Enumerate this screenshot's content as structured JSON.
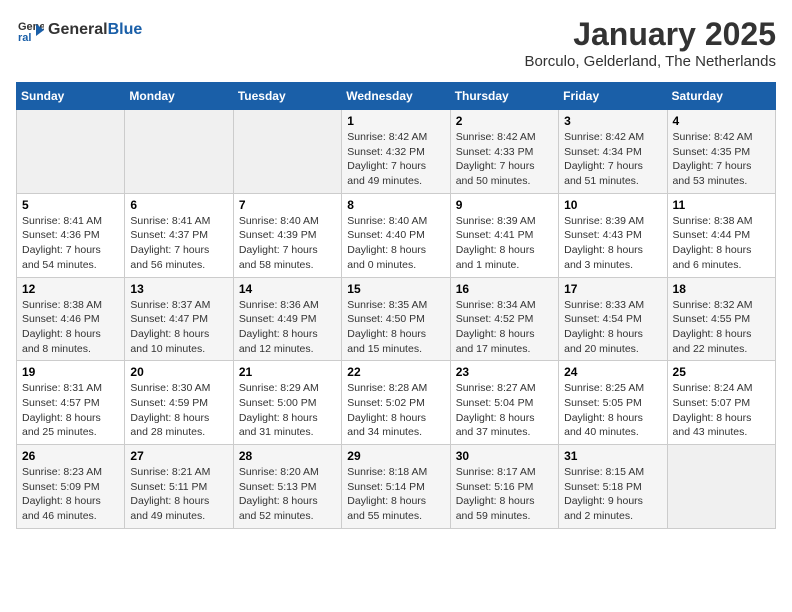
{
  "header": {
    "logo_general": "General",
    "logo_blue": "Blue",
    "title": "January 2025",
    "subtitle": "Borculo, Gelderland, The Netherlands"
  },
  "days_of_week": [
    "Sunday",
    "Monday",
    "Tuesday",
    "Wednesday",
    "Thursday",
    "Friday",
    "Saturday"
  ],
  "weeks": [
    [
      {
        "day": "",
        "info": ""
      },
      {
        "day": "",
        "info": ""
      },
      {
        "day": "",
        "info": ""
      },
      {
        "day": "1",
        "info": "Sunrise: 8:42 AM\nSunset: 4:32 PM\nDaylight: 7 hours and 49 minutes."
      },
      {
        "day": "2",
        "info": "Sunrise: 8:42 AM\nSunset: 4:33 PM\nDaylight: 7 hours and 50 minutes."
      },
      {
        "day": "3",
        "info": "Sunrise: 8:42 AM\nSunset: 4:34 PM\nDaylight: 7 hours and 51 minutes."
      },
      {
        "day": "4",
        "info": "Sunrise: 8:42 AM\nSunset: 4:35 PM\nDaylight: 7 hours and 53 minutes."
      }
    ],
    [
      {
        "day": "5",
        "info": "Sunrise: 8:41 AM\nSunset: 4:36 PM\nDaylight: 7 hours and 54 minutes."
      },
      {
        "day": "6",
        "info": "Sunrise: 8:41 AM\nSunset: 4:37 PM\nDaylight: 7 hours and 56 minutes."
      },
      {
        "day": "7",
        "info": "Sunrise: 8:40 AM\nSunset: 4:39 PM\nDaylight: 7 hours and 58 minutes."
      },
      {
        "day": "8",
        "info": "Sunrise: 8:40 AM\nSunset: 4:40 PM\nDaylight: 8 hours and 0 minutes."
      },
      {
        "day": "9",
        "info": "Sunrise: 8:39 AM\nSunset: 4:41 PM\nDaylight: 8 hours and 1 minute."
      },
      {
        "day": "10",
        "info": "Sunrise: 8:39 AM\nSunset: 4:43 PM\nDaylight: 8 hours and 3 minutes."
      },
      {
        "day": "11",
        "info": "Sunrise: 8:38 AM\nSunset: 4:44 PM\nDaylight: 8 hours and 6 minutes."
      }
    ],
    [
      {
        "day": "12",
        "info": "Sunrise: 8:38 AM\nSunset: 4:46 PM\nDaylight: 8 hours and 8 minutes."
      },
      {
        "day": "13",
        "info": "Sunrise: 8:37 AM\nSunset: 4:47 PM\nDaylight: 8 hours and 10 minutes."
      },
      {
        "day": "14",
        "info": "Sunrise: 8:36 AM\nSunset: 4:49 PM\nDaylight: 8 hours and 12 minutes."
      },
      {
        "day": "15",
        "info": "Sunrise: 8:35 AM\nSunset: 4:50 PM\nDaylight: 8 hours and 15 minutes."
      },
      {
        "day": "16",
        "info": "Sunrise: 8:34 AM\nSunset: 4:52 PM\nDaylight: 8 hours and 17 minutes."
      },
      {
        "day": "17",
        "info": "Sunrise: 8:33 AM\nSunset: 4:54 PM\nDaylight: 8 hours and 20 minutes."
      },
      {
        "day": "18",
        "info": "Sunrise: 8:32 AM\nSunset: 4:55 PM\nDaylight: 8 hours and 22 minutes."
      }
    ],
    [
      {
        "day": "19",
        "info": "Sunrise: 8:31 AM\nSunset: 4:57 PM\nDaylight: 8 hours and 25 minutes."
      },
      {
        "day": "20",
        "info": "Sunrise: 8:30 AM\nSunset: 4:59 PM\nDaylight: 8 hours and 28 minutes."
      },
      {
        "day": "21",
        "info": "Sunrise: 8:29 AM\nSunset: 5:00 PM\nDaylight: 8 hours and 31 minutes."
      },
      {
        "day": "22",
        "info": "Sunrise: 8:28 AM\nSunset: 5:02 PM\nDaylight: 8 hours and 34 minutes."
      },
      {
        "day": "23",
        "info": "Sunrise: 8:27 AM\nSunset: 5:04 PM\nDaylight: 8 hours and 37 minutes."
      },
      {
        "day": "24",
        "info": "Sunrise: 8:25 AM\nSunset: 5:05 PM\nDaylight: 8 hours and 40 minutes."
      },
      {
        "day": "25",
        "info": "Sunrise: 8:24 AM\nSunset: 5:07 PM\nDaylight: 8 hours and 43 minutes."
      }
    ],
    [
      {
        "day": "26",
        "info": "Sunrise: 8:23 AM\nSunset: 5:09 PM\nDaylight: 8 hours and 46 minutes."
      },
      {
        "day": "27",
        "info": "Sunrise: 8:21 AM\nSunset: 5:11 PM\nDaylight: 8 hours and 49 minutes."
      },
      {
        "day": "28",
        "info": "Sunrise: 8:20 AM\nSunset: 5:13 PM\nDaylight: 8 hours and 52 minutes."
      },
      {
        "day": "29",
        "info": "Sunrise: 8:18 AM\nSunset: 5:14 PM\nDaylight: 8 hours and 55 minutes."
      },
      {
        "day": "30",
        "info": "Sunrise: 8:17 AM\nSunset: 5:16 PM\nDaylight: 8 hours and 59 minutes."
      },
      {
        "day": "31",
        "info": "Sunrise: 8:15 AM\nSunset: 5:18 PM\nDaylight: 9 hours and 2 minutes."
      },
      {
        "day": "",
        "info": ""
      }
    ]
  ]
}
